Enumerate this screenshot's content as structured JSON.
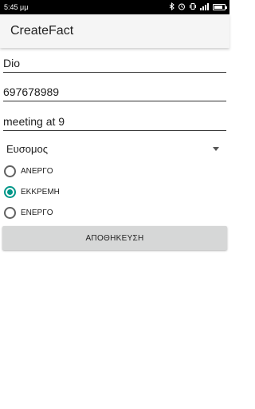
{
  "status_bar": {
    "time": "5:45 μμ",
    "icons": [
      "bluetooth-icon",
      "alarm-icon",
      "vibrate-icon",
      "signal-icon",
      "battery-icon"
    ],
    "battery_level": 0.85
  },
  "app_bar": {
    "title": "CreateFact"
  },
  "form": {
    "name_value": "Dio",
    "phone_value": "697678989",
    "note_value": "meeting at 9",
    "spinner_selected": "Ευσομος",
    "radios": [
      {
        "label": "ΑΝΕΡΓΟ",
        "checked": false
      },
      {
        "label": "ΕΚΚΡΕΜΗ",
        "checked": true
      },
      {
        "label": "ΕΝΕΡΓΟ",
        "checked": false
      }
    ],
    "save_label": "ΑΠΟΘΗΚΕΥΣΗ"
  },
  "colors": {
    "accent": "#009688",
    "app_bar": "#f5f5f5",
    "button": "#d6d7d7"
  }
}
